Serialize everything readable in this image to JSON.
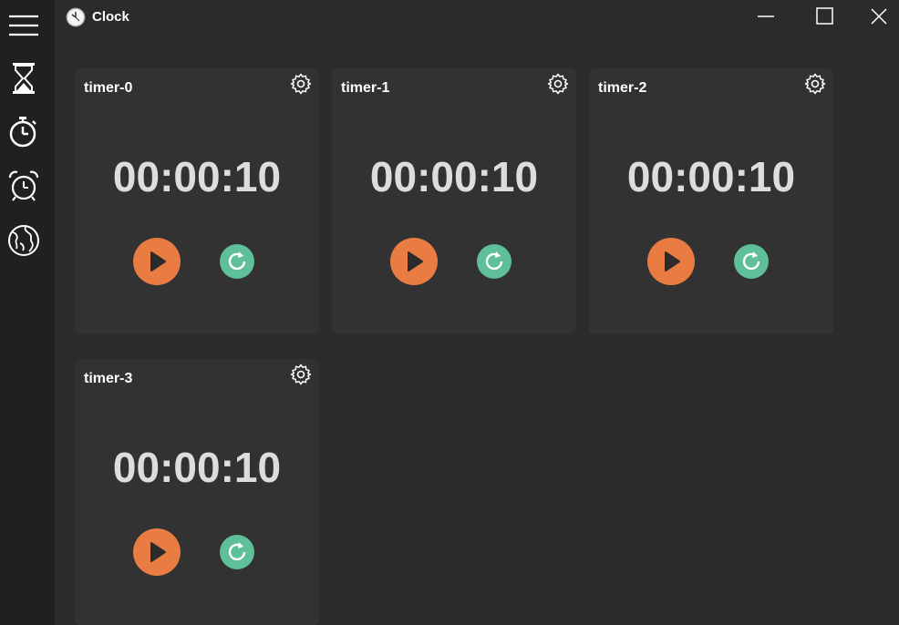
{
  "window": {
    "title": "Clock",
    "controls": [
      "minimize",
      "maximize",
      "close"
    ]
  },
  "sidebar": {
    "items": [
      {
        "icon": "menu-icon"
      },
      {
        "icon": "hourglass-icon"
      },
      {
        "icon": "stopwatch-icon"
      },
      {
        "icon": "alarm-clock-icon"
      },
      {
        "icon": "globe-icon"
      }
    ]
  },
  "timers": [
    {
      "name": "timer-0",
      "time": "00:00:10"
    },
    {
      "name": "timer-1",
      "time": "00:00:10"
    },
    {
      "name": "timer-2",
      "time": "00:00:10"
    },
    {
      "name": "timer-3",
      "time": "00:00:10"
    }
  ],
  "colors": {
    "background": "#2b2b2b",
    "sidebar": "#202020",
    "card": "#323232",
    "play": "#e87c43",
    "reset": "#5fbf98",
    "time_text": "#dddddd"
  }
}
